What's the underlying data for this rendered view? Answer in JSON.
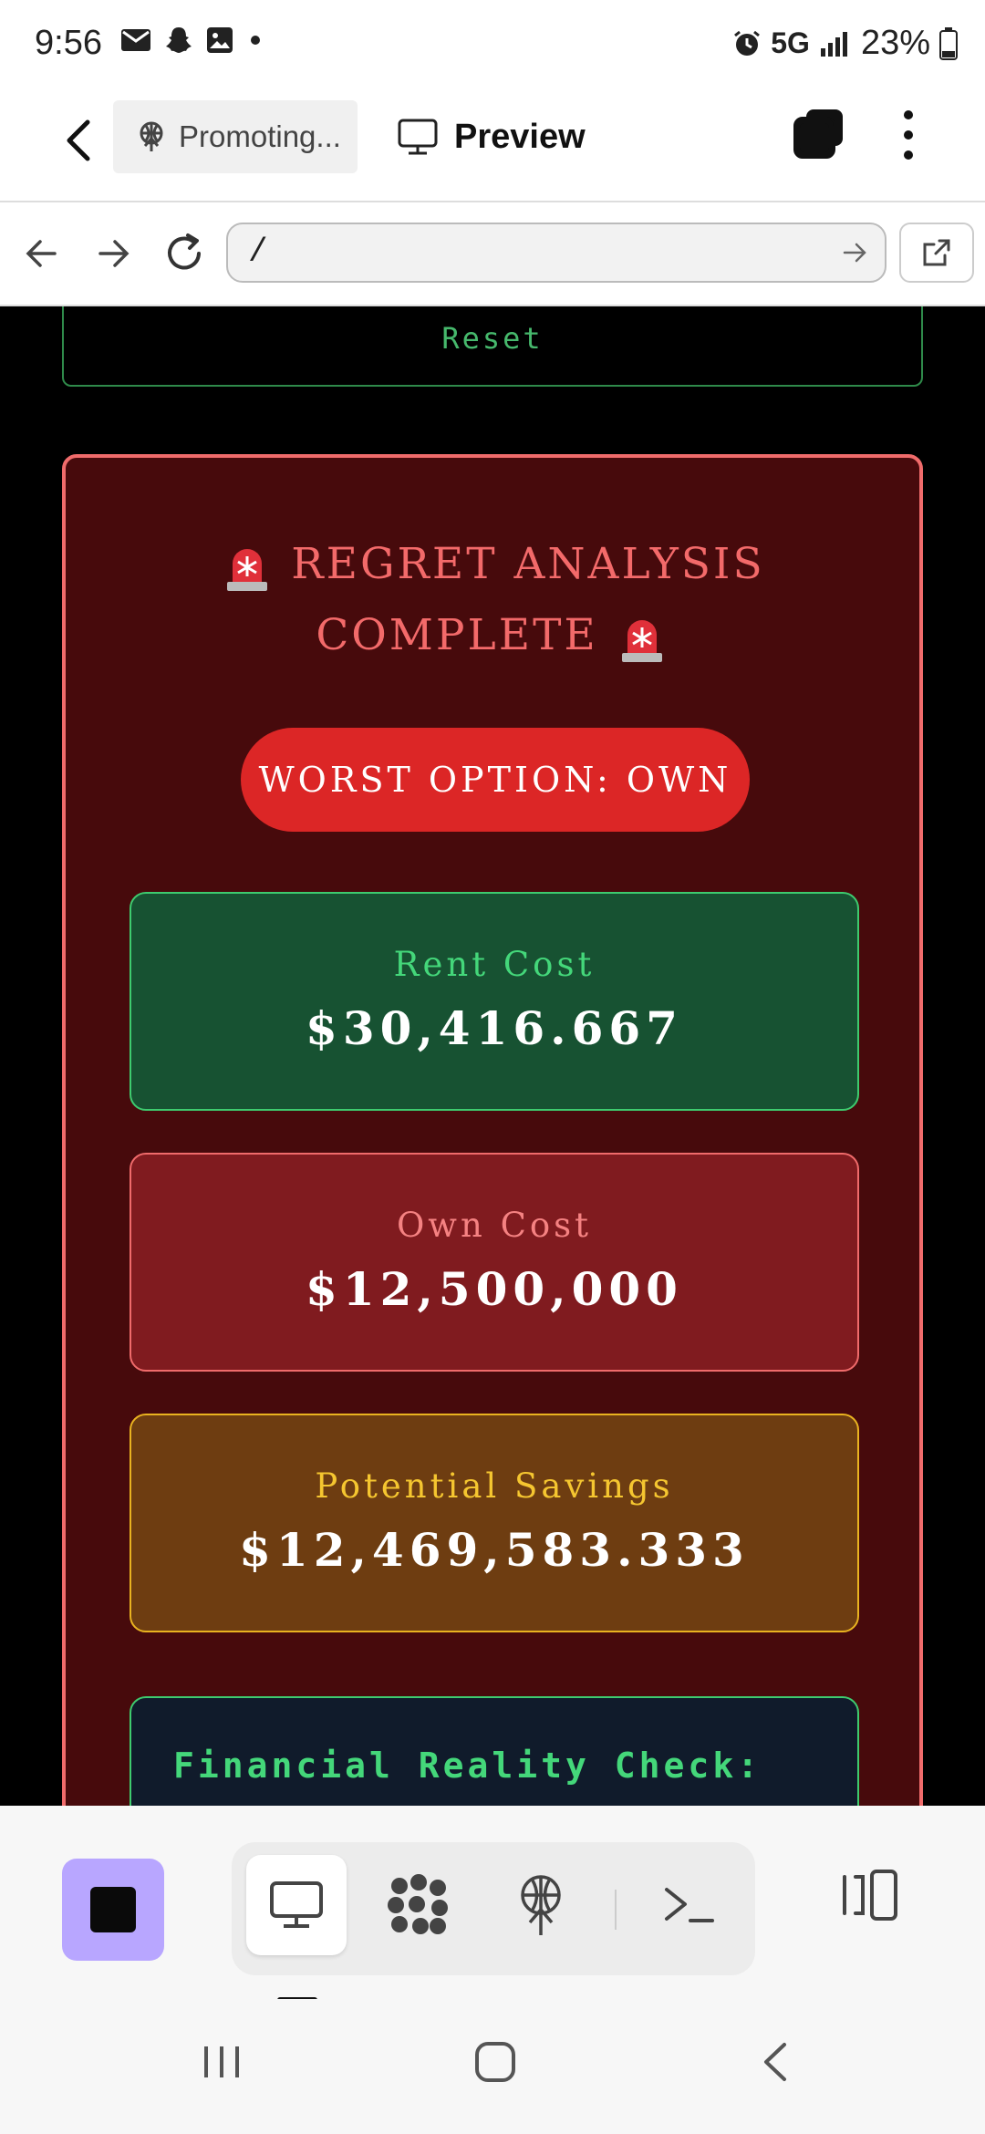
{
  "status_bar": {
    "time": "9:56",
    "icons": [
      "mail-icon",
      "snapchat-icon",
      "image-icon",
      "dot-icon"
    ],
    "network": "5G",
    "battery": "23%"
  },
  "app_bar": {
    "promo_chip_label": "Promoting...",
    "preview_label": "Preview"
  },
  "url_bar": {
    "url": "/"
  },
  "page": {
    "reset_label": "Reset",
    "regret_title_line1": "REGRET ANALYSIS",
    "regret_title_line2": "COMPLETE",
    "worst_option": "WORST OPTION: OWN",
    "stats": {
      "rent_label": "Rent Cost",
      "rent_value": "$30,416.667",
      "own_label": "Own Cost",
      "own_value": "$12,500,000",
      "savings_label": "Potential Savings",
      "savings_value": "$12,469,583.333"
    },
    "reality_title": "Financial Reality Check:"
  },
  "colors": {
    "accent_stop": "#b8a6ff",
    "regret_bg": "#470a0c",
    "regret_border": "#f06b6b",
    "badge_red": "#dc2626",
    "rent_green": "#175232",
    "own_red": "#801b1f",
    "savings_brown": "#6e3d11"
  }
}
